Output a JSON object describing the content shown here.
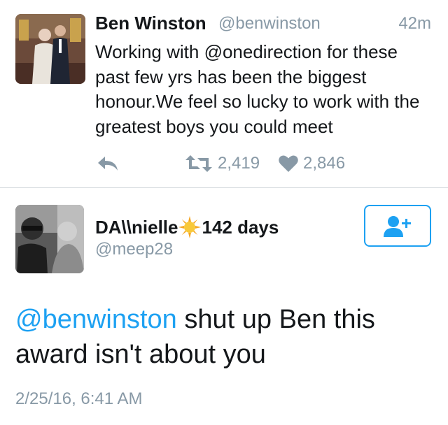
{
  "tweet1": {
    "name": "Ben Winston",
    "handle": "@benwinston",
    "time": "42m",
    "text": "Working with @onedirection for these past few yrs has been the biggest honour.We feel so lucky to work with the greatest boys you could meet",
    "retweet_count": "2,419",
    "like_count": "2,846",
    "avatar_icon": "avatar-photo"
  },
  "tweet2": {
    "name_part1": "DA\\\\nielle",
    "name_part2": "142 days",
    "name_emoji": "sun-emoji",
    "handle": "@meep28",
    "text_mention": "@benwinston",
    "text_body": " shut up Ben this award isn't about you",
    "date": "2/25/16, 6:41 AM",
    "follow_icon": "add-user-icon"
  },
  "colors": {
    "accent": "#1da1f2",
    "muted": "#8899a6",
    "text": "#14171a",
    "divider": "#d8dde1"
  }
}
